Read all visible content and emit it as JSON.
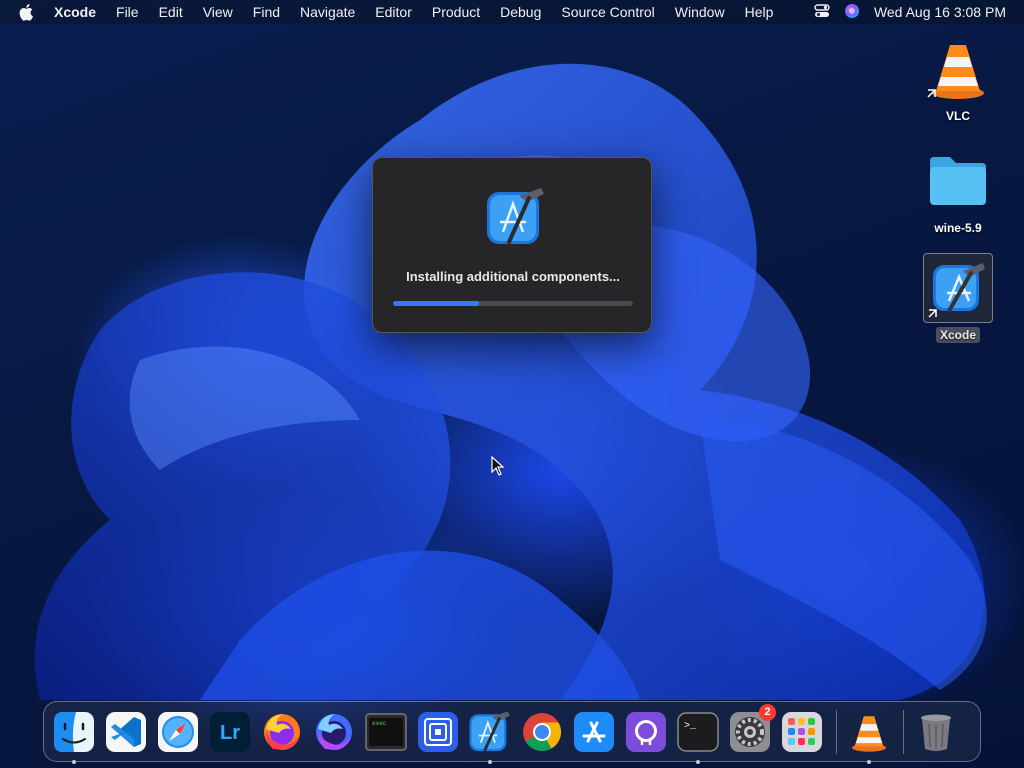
{
  "menubar": {
    "app_name": "Xcode",
    "items": [
      "File",
      "Edit",
      "View",
      "Find",
      "Navigate",
      "Editor",
      "Product",
      "Debug",
      "Source Control",
      "Window",
      "Help"
    ],
    "clock": "Wed Aug 16  3:08 PM",
    "status_icons": [
      "control-center-icon",
      "siri-icon"
    ]
  },
  "desktop": {
    "icons": [
      {
        "label": "VLC",
        "icon": "vlc-cone-icon",
        "alias": true
      },
      {
        "label": "wine-5.9",
        "icon": "folder-icon",
        "alias": false
      },
      {
        "label": "Xcode",
        "icon": "xcode-icon",
        "alias": true,
        "selected": true
      }
    ]
  },
  "dialog": {
    "message": "Installing additional components...",
    "progress_fraction": 0.36,
    "colors": {
      "progress_fill": "#2f7df6",
      "track": "#4a4a4e"
    }
  },
  "dock": {
    "apps": [
      {
        "name": "Finder",
        "icon": "finder-icon",
        "running": true
      },
      {
        "name": "Visual Studio Code",
        "icon": "vscode-icon",
        "running": false
      },
      {
        "name": "Safari",
        "icon": "safari-icon",
        "running": false
      },
      {
        "name": "Lightroom",
        "icon": "lightroom-icon",
        "icon_text": "Lr",
        "running": false
      },
      {
        "name": "Firefox",
        "icon": "firefox-icon",
        "running": false
      },
      {
        "name": "Firefox Developer",
        "icon": "firefox-dev-icon",
        "running": false
      },
      {
        "name": "Console",
        "icon": "console-icon",
        "icon_text": "exec",
        "running": false
      },
      {
        "name": "Simulator",
        "icon": "simulator-icon",
        "running": false
      },
      {
        "name": "Xcode",
        "icon": "xcode-icon",
        "running": true
      },
      {
        "name": "Chrome",
        "icon": "chrome-icon",
        "running": false
      },
      {
        "name": "App Store",
        "icon": "app-store-icon",
        "running": false
      },
      {
        "name": "GitHub Desktop",
        "icon": "github-icon",
        "running": false
      },
      {
        "name": "Terminal",
        "icon": "terminal-icon",
        "icon_text": ">_",
        "running": true
      },
      {
        "name": "System Settings",
        "icon": "settings-gear-icon",
        "badge": "2",
        "running": false
      },
      {
        "name": "Launchpad",
        "icon": "launchpad-icon",
        "running": false
      }
    ],
    "extras": [
      {
        "name": "VLC",
        "icon": "vlc-cone-icon",
        "running": true
      },
      {
        "name": "Trash",
        "icon": "trash-icon",
        "running": false
      }
    ]
  }
}
